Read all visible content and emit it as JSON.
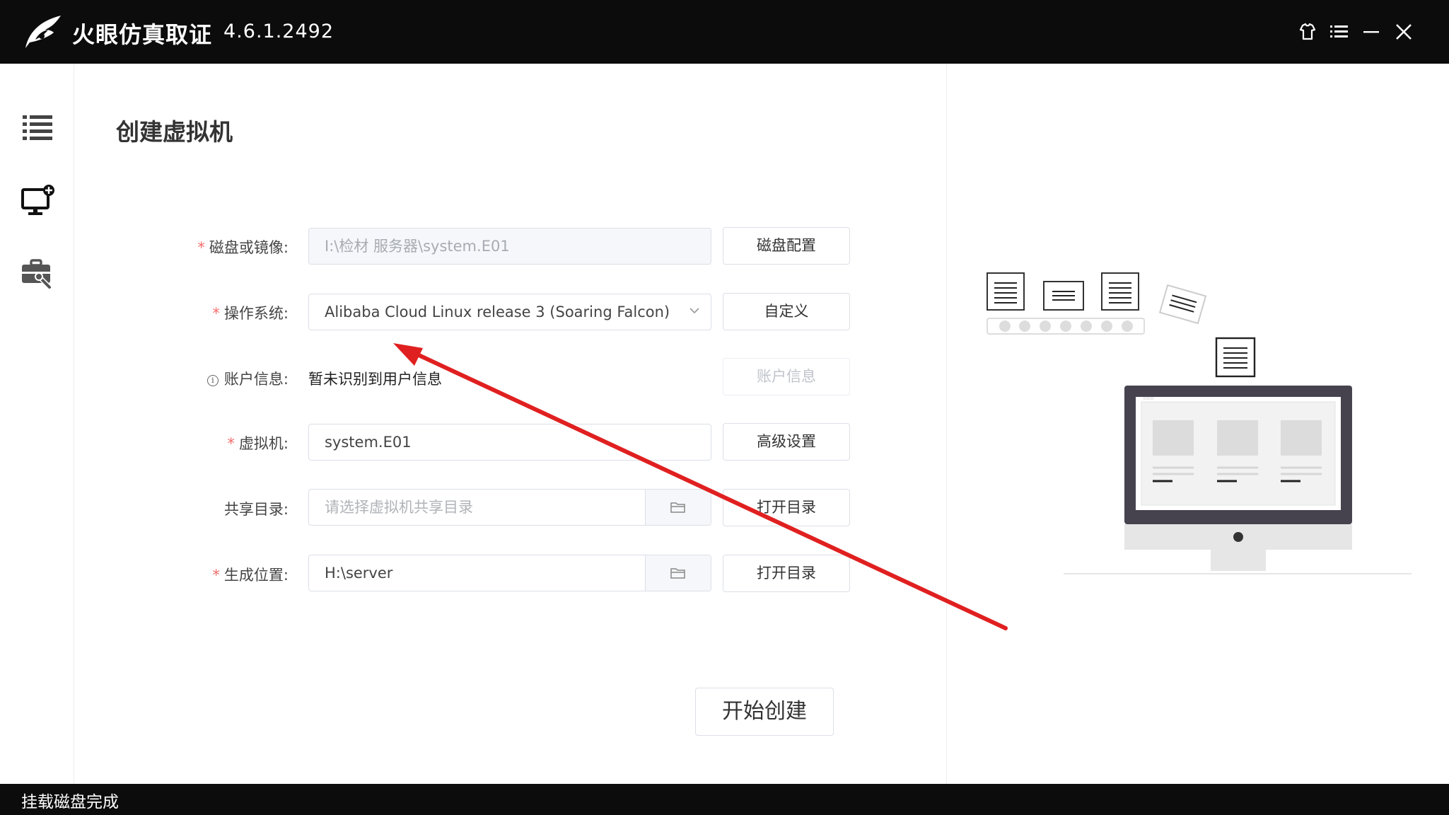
{
  "titlebar": {
    "app_name": "火眼仿真取证",
    "version": "4.6.1.2492",
    "buttons": [
      "skin-icon",
      "menu-icon",
      "minimize-icon",
      "close-icon"
    ]
  },
  "sidebar": {
    "items": [
      {
        "icon": "list-icon"
      },
      {
        "icon": "monitor-add-icon"
      },
      {
        "icon": "toolbox-icon"
      }
    ]
  },
  "main": {
    "title": "创建虚拟机",
    "form": {
      "disk_label": "磁盘或镜像:",
      "disk_value": "I:\\检材 服务器\\system.E01",
      "disk_button": "磁盘配置",
      "os_label": "操作系统:",
      "os_value": "Alibaba Cloud Linux release 3 (Soaring Falcon)",
      "os_button": "自定义",
      "account_label": "账户信息:",
      "account_value": "暂未识别到用户信息",
      "account_button": "账户信息",
      "vm_label": "虚拟机:",
      "vm_value": "system.E01",
      "vm_button": "高级设置",
      "share_label": "共享目录:",
      "share_placeholder": "请选择虚拟机共享目录",
      "share_button": "打开目录",
      "output_label": "生成位置:",
      "output_value": "H:\\server",
      "output_button": "打开目录",
      "required_mark": "*"
    },
    "start_button": "开始创建"
  },
  "status": {
    "text": "挂载磁盘完成"
  },
  "colors": {
    "titlebar_bg": "#0c0c0c",
    "required": "#f56c6c",
    "annotation_arrow": "#e02020",
    "monitor_frame": "#46434f"
  }
}
